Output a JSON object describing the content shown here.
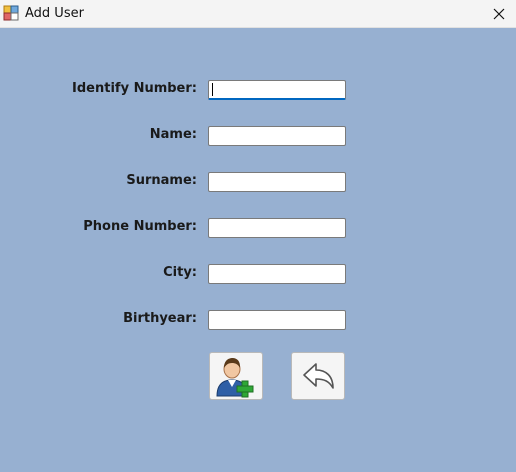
{
  "window": {
    "title": "Add User",
    "app_icon": "winforms-app-icon",
    "close_icon": "close-icon"
  },
  "form": {
    "fields": [
      {
        "label": "Identify Number:",
        "value": "",
        "focused": true
      },
      {
        "label": "Name:",
        "value": ""
      },
      {
        "label": "Surname:",
        "value": ""
      },
      {
        "label": "Phone Number:",
        "value": ""
      },
      {
        "label": "City:",
        "value": ""
      },
      {
        "label": "Birthyear:",
        "value": ""
      }
    ]
  },
  "actions": {
    "add_user_icon": "add-user-icon",
    "back_icon": "back-arrow-icon"
  },
  "colors": {
    "background": "#97b0d1",
    "titlebar": "#f4f4f4",
    "focus_accent": "#0067c0",
    "add_plus": "#2fa836"
  }
}
